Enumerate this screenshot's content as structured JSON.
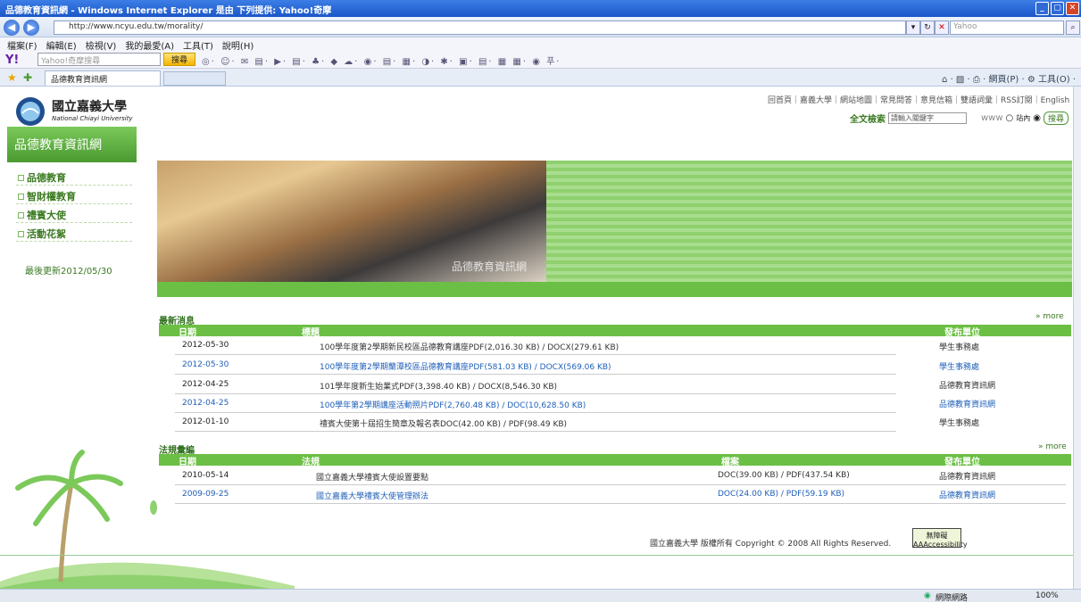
{
  "window": {
    "title": "品德教育資訊網 - Windows Internet Explorer 是由 下列提供: Yahoo!奇摩"
  },
  "address": {
    "url": "http://www.ncyu.edu.tw/morality/",
    "search_placeholder": "Yahoo"
  },
  "menu": [
    "檔案(F)",
    "編輯(E)",
    "檢視(V)",
    "我的最愛(A)",
    "工具(T)",
    "說明(H)"
  ],
  "yahoo": {
    "logo": "Y!",
    "search_placeholder": "Yahoo!奇摩搜尋",
    "search_btn": "搜尋",
    "icons": "◎· ☺· ✉ ▤· ▶· ▤· ♣· ◆ ☁· ◉· ▤· ▦· ◑· ✱· ▣· ▤· ▦ ▦· ◉ 푸·"
  },
  "tab": {
    "label": "品德教育資訊網",
    "tools": "⌂ · ▧ · ⎙ · 網頁(P) · ⚙ 工具(O) ·"
  },
  "site": {
    "name": "國立嘉義大學",
    "name_en": "National Chiayi University",
    "section_title": "品德教育資訊網",
    "sidebar": [
      "品德教育",
      "智財權教育",
      "禮賓大使",
      "活動花絮"
    ],
    "last_updated": "最後更新2012/05/30",
    "toplinks": "回首頁｜嘉義大學｜網站地圖｜常見問答｜意見信箱｜雙語詞彙｜RSS訂閱｜English",
    "fulltext_label": "全文檢索",
    "fulltext_placeholder": "請輸入關鍵字",
    "scope_www": "www",
    "scope_site": "站內",
    "search_btn": "搜尋",
    "banner_text": "品德教育資訊網"
  },
  "news": {
    "title": "最新消息",
    "more": "» more",
    "headers": [
      "日期",
      "標題",
      "發布單位"
    ],
    "rows": [
      {
        "date": "2012-05-30",
        "title": "100學年度第2學期新民校區品德教育講座PDF(2,016.30 KB) / DOCX(279.61 KB)",
        "unit": "學生事務處",
        "color": "dark"
      },
      {
        "date": "2012-05-30",
        "title": "100學年度第2學期蘭潭校區品德教育講座PDF(581.03 KB) / DOCX(569.06 KB)",
        "unit": "學生事務處",
        "color": "blue"
      },
      {
        "date": "2012-04-25",
        "title": "101學年度新生始業式PDF(3,398.40 KB) / DOCX(8,546.30 KB)",
        "unit": "品德教育資訊網",
        "color": "dark"
      },
      {
        "date": "2012-04-25",
        "title": "100學年第2學期講座活動照片PDF(2,760.48 KB) / DOC(10,628.50 KB)",
        "unit": "品德教育資訊網",
        "color": "blue"
      },
      {
        "date": "2012-01-10",
        "title": "禮賓大使第十屆招生簡章及報名表DOC(42.00 KB) / PDF(98.49 KB)",
        "unit": "學生事務處",
        "color": "dark"
      }
    ]
  },
  "laws": {
    "title": "法規彙編",
    "more": "» more",
    "headers": [
      "日期",
      "法規",
      "檔案",
      "發布單位"
    ],
    "rows": [
      {
        "date": "2010-05-14",
        "title": "國立嘉義大學禮賓大使設置要點",
        "file": "DOC(39.00 KB) / PDF(437.54 KB)",
        "unit": "品德教育資訊網",
        "color": "dark"
      },
      {
        "date": "2009-09-25",
        "title": "國立嘉義大學禮賓大使管理辦法",
        "file": "DOC(24.00 KB) / PDF(59.19 KB)",
        "unit": "品德教育資訊網",
        "color": "blue"
      }
    ]
  },
  "footer": {
    "text": "國立嘉義大學  版權所有  Copyright © 2008 All Rights Reserved.",
    "badge": "無障礙 AAAccessibility"
  },
  "status": {
    "zone": "網際網路",
    "zoom": "100%"
  }
}
